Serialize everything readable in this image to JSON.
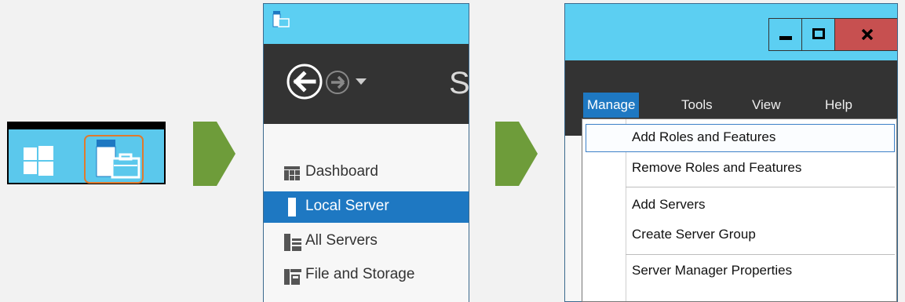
{
  "taskbar": {
    "start_icon": "windows-logo-icon",
    "server_manager_icon": "server-manager-icon",
    "highlight_color": "#e07a2d",
    "bar_color": "#5bc8ec"
  },
  "arrows": {
    "color": "#6e9c3a",
    "icon": "right-arrow-icon"
  },
  "server_manager": {
    "title_partial": "S",
    "back_icon": "back-arrow-icon",
    "forward_icon": "forward-arrow-icon",
    "nav": [
      {
        "label": "Dashboard",
        "icon": "dashboard-icon",
        "selected": false
      },
      {
        "label": "Local Server",
        "icon": "local-server-icon",
        "selected": true
      },
      {
        "label": "All Servers",
        "icon": "all-servers-icon",
        "selected": false
      },
      {
        "label": "File and Storage",
        "icon": "file-storage-icon",
        "selected": false
      }
    ],
    "accent": "#1e78c2"
  },
  "window_controls": {
    "minimize_icon": "minimize-icon",
    "maximize_icon": "maximize-icon",
    "close_icon": "close-icon",
    "close_color": "#c75050"
  },
  "menu_bar": {
    "items": [
      "Manage",
      "Tools",
      "View",
      "Help"
    ],
    "active": "Manage"
  },
  "manage_menu": {
    "items": [
      "Add Roles and Features",
      "Remove Roles and Features",
      "Add Servers",
      "Create Server Group",
      "Server Manager Properties"
    ],
    "hovered": "Add Roles and Features"
  }
}
